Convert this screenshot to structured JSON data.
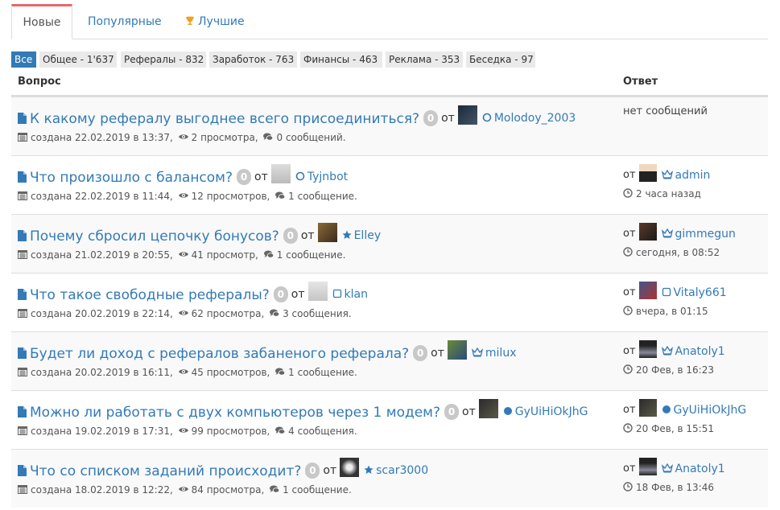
{
  "tabs": [
    {
      "label": "Новые"
    },
    {
      "label": "Популярные"
    },
    {
      "label": "Лучшие"
    }
  ],
  "filters": [
    {
      "label": "Все"
    },
    {
      "label": "Общее - 1'637"
    },
    {
      "label": "Рефералы - 832"
    },
    {
      "label": "Заработок - 763"
    },
    {
      "label": "Финансы - 463"
    },
    {
      "label": "Реклама - 353"
    },
    {
      "label": "Беседка - 97"
    }
  ],
  "table": {
    "col_question": "Вопрос",
    "col_answer": "Ответ"
  },
  "rows": [
    {
      "title": "К какому рефералу выгоднее всего присоединиться?",
      "count": "0",
      "ot": "от",
      "author": "Molodoy_2003",
      "role": "circle",
      "meta_created": "создана 22.02.2019 в 13:37,",
      "meta_views": "2 просмотра,",
      "meta_msgs": "0 сообщений.",
      "answer": {
        "none": "нет сообщений"
      }
    },
    {
      "title": "Что произошло с балансом?",
      "count": "0",
      "ot": "от",
      "author": "Tyjnbot",
      "role": "circle",
      "meta_created": "создана 22.02.2019 в 11:44,",
      "meta_views": "12 просмотров,",
      "meta_msgs": "1 сообщение.",
      "answer": {
        "ot": "от",
        "user": "admin",
        "role": "crown",
        "time": "2 часа назад"
      }
    },
    {
      "title": "Почему сбросил цепочку бонусов?",
      "count": "0",
      "ot": "от",
      "author": "Elley",
      "role": "star",
      "meta_created": "создана 21.02.2019 в 20:55,",
      "meta_views": "41 просмотр,",
      "meta_msgs": "1 сообщение.",
      "answer": {
        "ot": "от",
        "user": "gimmegun",
        "role": "crown",
        "time": "сегодня, в 08:52"
      }
    },
    {
      "title": "Что такое свободные рефералы?",
      "count": "0",
      "ot": "от",
      "author": "klan",
      "role": "square",
      "meta_created": "создана 20.02.2019 в 22:14,",
      "meta_views": "62 просмотра,",
      "meta_msgs": "3 сообщения.",
      "answer": {
        "ot": "от",
        "user": "Vitaly661",
        "role": "square",
        "time": "вчера, в 01:15"
      }
    },
    {
      "title": "Будет ли доход с рефералов забаненого реферала?",
      "count": "0",
      "ot": "от",
      "author": "milux",
      "role": "crown",
      "meta_created": "создана 20.02.2019 в 16:11,",
      "meta_views": "45 просмотров,",
      "meta_msgs": "1 сообщение.",
      "answer": {
        "ot": "от",
        "user": "Anatoly1",
        "role": "crown",
        "time": "20 Фев, в 16:23"
      }
    },
    {
      "title": "Можно ли работать с двух компьютеров через 1 модем?",
      "count": "0",
      "ot": "от",
      "author": "GyUiHiOkJhG",
      "role": "dot",
      "meta_created": "создана 19.02.2019 в 17:31,",
      "meta_views": "99 просмотров,",
      "meta_msgs": "4 сообщения.",
      "answer": {
        "ot": "от",
        "user": "GyUiHiOkJhG",
        "role": "dot",
        "time": "20 Фев, в 15:51"
      }
    },
    {
      "title": "Что со списком заданий происходит?",
      "count": "0",
      "ot": "от",
      "author": "scar3000",
      "role": "star",
      "meta_created": "создана 18.02.2019 в 12:22,",
      "meta_views": "84 просмотра,",
      "meta_msgs": "1 сообщение.",
      "answer": {
        "ot": "от",
        "user": "Anatoly1",
        "role": "crown",
        "time": "18 Фев, в 13:46"
      }
    }
  ],
  "colors": {
    "link": "#337ab7",
    "active_tab_border": "#e8686b",
    "chip_active": "#337ab7",
    "badge": "#c8c8c8"
  }
}
